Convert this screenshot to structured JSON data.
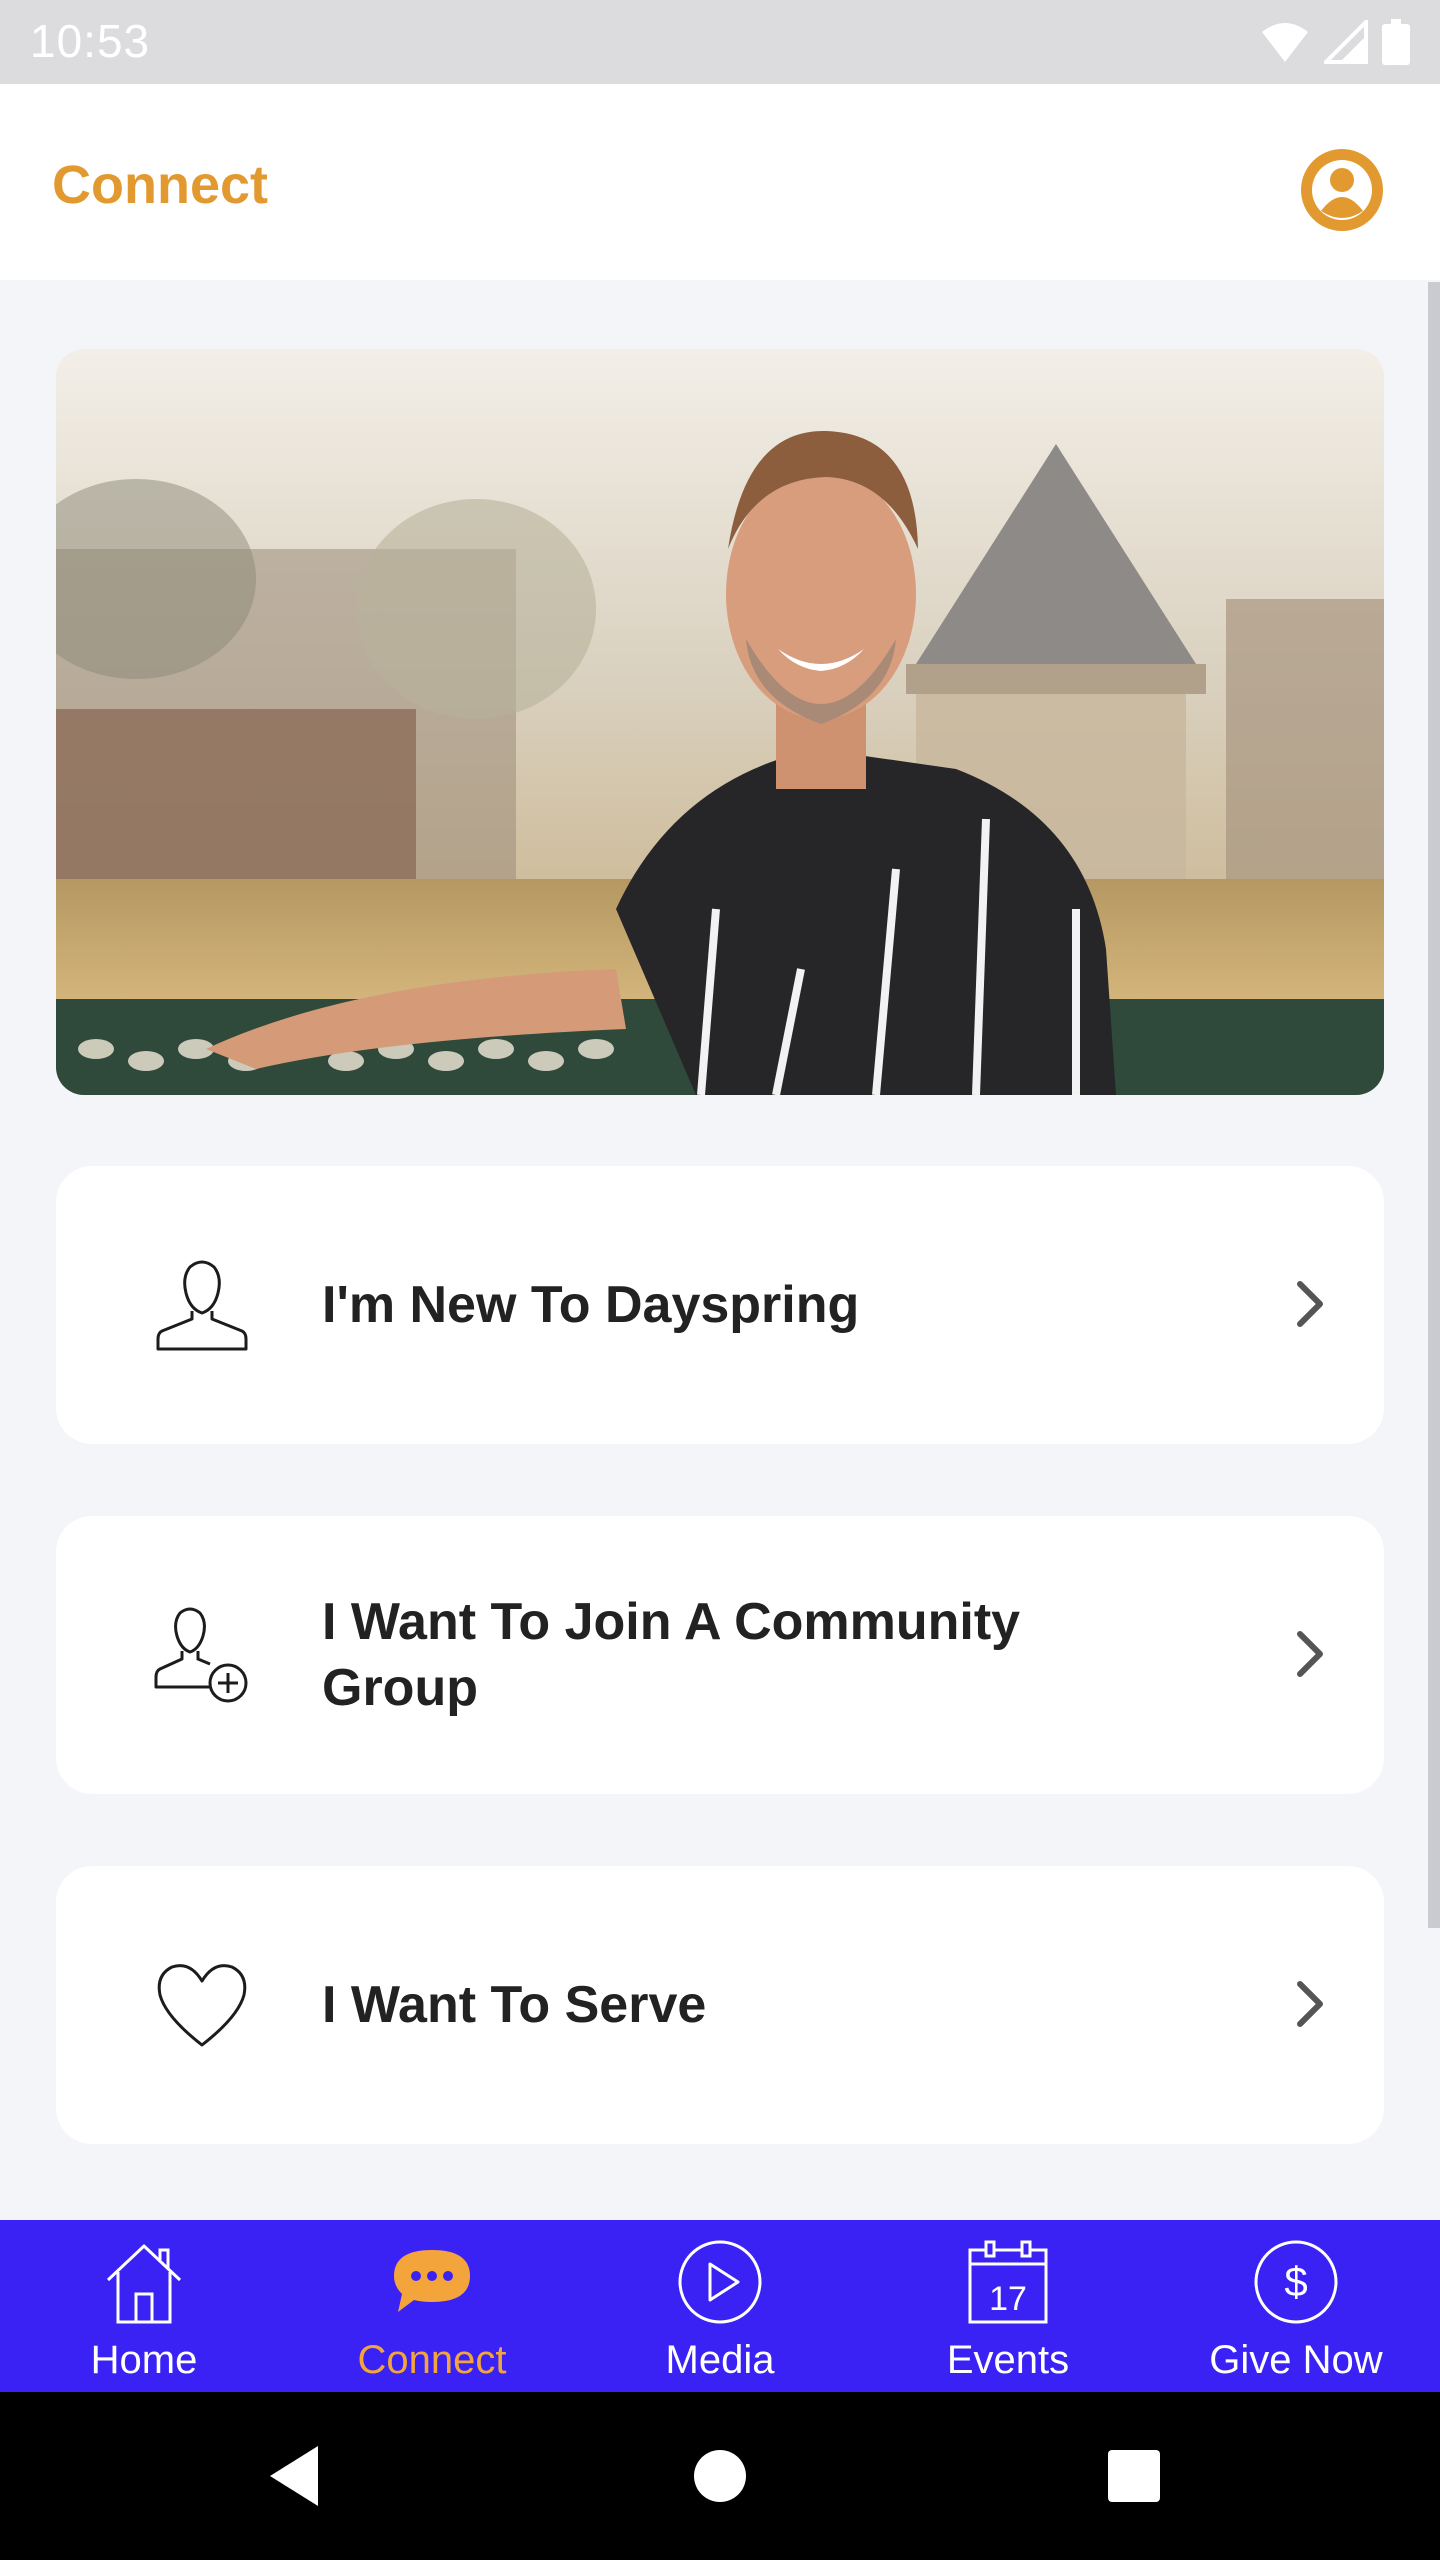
{
  "status_bar": {
    "time": "10:53",
    "icons": [
      "wifi-icon",
      "signal-icon",
      "battery-icon"
    ]
  },
  "header": {
    "title": "Connect",
    "profile_icon": "profile-icon"
  },
  "hero": {
    "image": "person-smiling-outdoor-photo"
  },
  "cards": [
    {
      "label": "I'm New To Dayspring",
      "icon": "person-icon"
    },
    {
      "label": "I Want To Join A Community Group",
      "icon": "person-add-icon"
    },
    {
      "label": "I Want To Serve",
      "icon": "heart-icon"
    }
  ],
  "bottom_nav": {
    "items": [
      {
        "label": "Home",
        "icon": "home-icon",
        "active": false
      },
      {
        "label": "Connect",
        "icon": "chat-bubble-icon",
        "active": true
      },
      {
        "label": "Media",
        "icon": "play-icon",
        "active": false
      },
      {
        "label": "Events",
        "icon": "calendar-icon",
        "active": false,
        "calendar_day": "17"
      },
      {
        "label": "Give Now",
        "icon": "dollar-icon",
        "active": false
      }
    ]
  },
  "colors": {
    "accent": "#e29a30",
    "nav_background": "#3a22f5",
    "nav_active": "#f3a43b",
    "page_background": "#f4f5f9"
  }
}
